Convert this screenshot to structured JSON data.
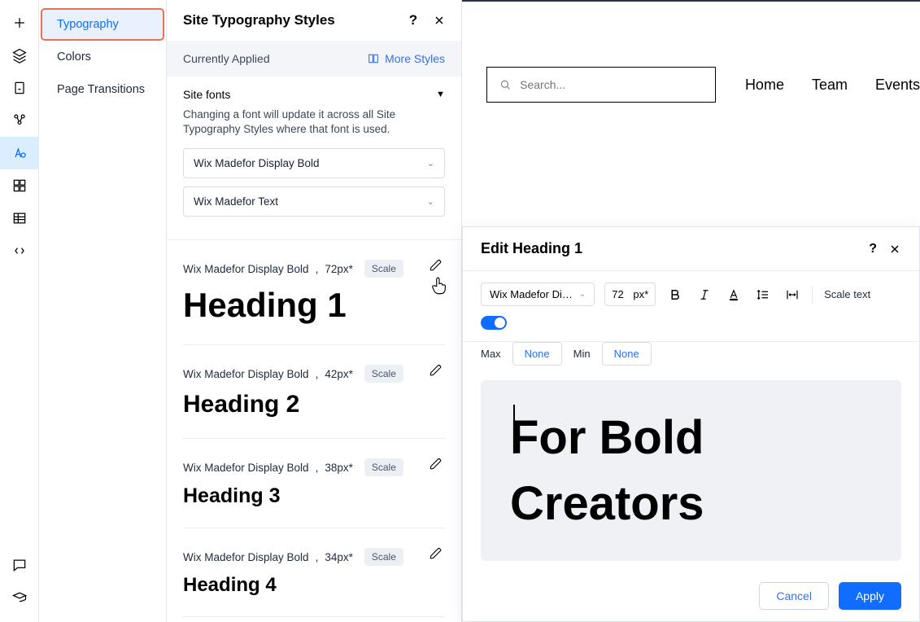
{
  "menu": {
    "items": [
      "Typography",
      "Colors",
      "Page Transitions"
    ],
    "selected": 0
  },
  "typography_panel": {
    "title": "Site Typography Styles",
    "currently_applied": "Currently Applied",
    "more_styles": "More Styles",
    "site_fonts_label": "Site fonts",
    "site_fonts_desc": "Changing a font will update it across all Site Typography Styles where that font is used.",
    "font1": "Wix Madefor Display Bold",
    "font2": "Wix Madefor Text",
    "rows": [
      {
        "font": "Wix Madefor Display Bold",
        "size": "72px*",
        "scale": "Scale",
        "name": "Heading 1"
      },
      {
        "font": "Wix Madefor Display Bold",
        "size": "42px*",
        "scale": "Scale",
        "name": "Heading 2"
      },
      {
        "font": "Wix Madefor Display Bold",
        "size": "38px*",
        "scale": "Scale",
        "name": "Heading 3"
      },
      {
        "font": "Wix Madefor Display Bold",
        "size": "34px*",
        "scale": "Scale",
        "name": "Heading 4"
      }
    ]
  },
  "site": {
    "search_placeholder": "Search...",
    "nav": [
      "Home",
      "Team",
      "Events"
    ]
  },
  "modal": {
    "title": "Edit Heading 1",
    "font": "Wix Madefor Di…",
    "size": "72",
    "unit": "px*",
    "scale_label": "Scale text",
    "max_label": "Max",
    "max_value": "None",
    "min_label": "Min",
    "min_value": "None",
    "preview": "For Bold Creators",
    "cancel": "Cancel",
    "apply": "Apply"
  }
}
